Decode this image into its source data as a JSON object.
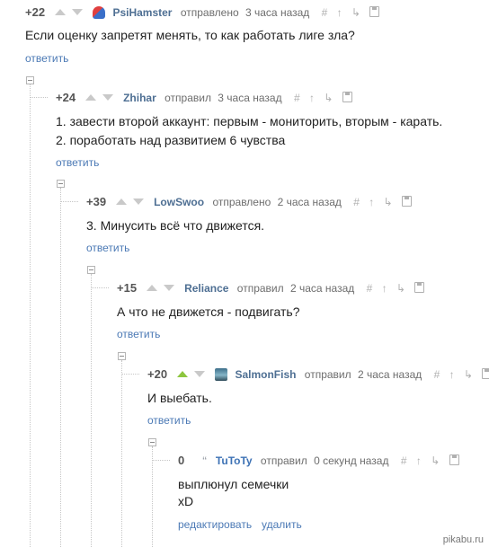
{
  "comments": [
    {
      "rating": "+22",
      "username": "PsiHamster",
      "avatar_icon": "unicorn-avatar-icon",
      "verb": "отправлено",
      "time": "3 часа назад",
      "lines": [
        "Если оценку запретят менять, то как работать лиге зла?"
      ],
      "actions": [
        "ответить"
      ]
    },
    {
      "rating": "+24",
      "username": "Zhihar",
      "verb": "отправил",
      "time": "3 часа назад",
      "lines": [
        "1. завести второй аккаунт: первым - мониторить, вторым - карать.",
        "2. поработать над развитием 6 чувства"
      ],
      "actions": [
        "ответить"
      ]
    },
    {
      "rating": "+39",
      "username": "LowSwoo",
      "verb": "отправлено",
      "time": "2 часа назад",
      "lines": [
        "3. Минусить всё что движется."
      ],
      "actions": [
        "ответить"
      ]
    },
    {
      "rating": "+15",
      "username": "Reliance",
      "verb": "отправил",
      "time": "2 часа назад",
      "lines": [
        "А что не движется - подвигать?"
      ],
      "actions": [
        "ответить"
      ]
    },
    {
      "rating": "+20",
      "username": "SalmonFish",
      "avatar_icon": "fish-avatar-icon",
      "upvoted": true,
      "verb": "отправил",
      "time": "2 часа назад",
      "lines": [
        "И выебать."
      ],
      "actions": [
        "ответить"
      ]
    },
    {
      "rating": "0",
      "username": "TuToTy",
      "avatar_icon": "quote-avatar-icon",
      "verb": "отправил",
      "time": "0 секунд назад",
      "lines": [
        "выплюнул семечки",
        "xD"
      ],
      "actions": [
        "редактировать",
        "удалить"
      ]
    }
  ],
  "tools": {
    "hash": "#",
    "up_arrow": "↑",
    "reply_arrow": "↳"
  },
  "colors": {
    "link": "#4b79b5",
    "username": "#4e6f93",
    "vote_active": "#8dc63f",
    "vote_inactive": "#c9c9c9"
  },
  "watermark": "pikabu.ru"
}
